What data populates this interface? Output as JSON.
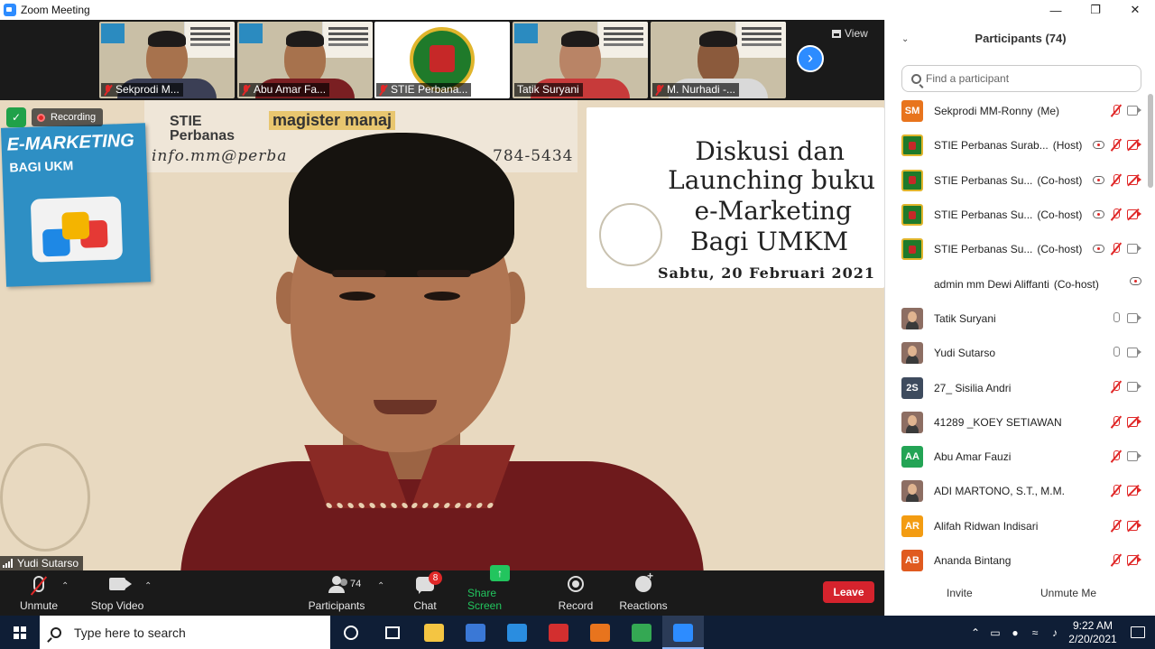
{
  "window": {
    "title": "Zoom Meeting"
  },
  "thumbnails": [
    {
      "name": "Sekprodi M..."
    },
    {
      "name": "Abu Amar Fa..."
    },
    {
      "name": "STIE Perbana..."
    },
    {
      "name": "Tatik Suryani"
    },
    {
      "name": "M. Nurhadi -..."
    }
  ],
  "view_label": "View",
  "main_video": {
    "recording_label": "Recording",
    "speaker_name": "Yudi Sutarso",
    "background": {
      "book_title_1": "E-MARKETING",
      "book_title_2": "BAGI UKM",
      "brand_1": "STIE\nPerbanas",
      "brand_2": "magister manaj",
      "email": "info.mm@perba",
      "phone": "784-5434",
      "event_line_1": "Diskusi dan",
      "event_line_2": "Launching buku",
      "event_line_3": "e-Marketing",
      "event_line_4": "Bagi UMKM",
      "event_date": "Sabtu, 20 Februari 2021"
    }
  },
  "toolbar": {
    "unmute": "Unmute",
    "stop_video": "Stop Video",
    "participants": "Participants",
    "participants_count": "74",
    "chat": "Chat",
    "chat_badge": "8",
    "share_screen": "Share Screen",
    "record": "Record",
    "reactions": "Reactions",
    "leave": "Leave"
  },
  "panel": {
    "title": "Participants (74)",
    "search_placeholder": "Find a participant",
    "invite": "Invite",
    "unmute_me": "Unmute Me",
    "participants": [
      {
        "initials": "SM",
        "color": "#e8741d",
        "avatar": "initials",
        "name": "Sekprodi MM-Ronny",
        "role": "(Me)",
        "cloud": false,
        "mic": "muted",
        "cam": "on"
      },
      {
        "initials": "",
        "color": "#1f7a2a",
        "avatar": "logo",
        "name": "STIE Perbanas Surab...",
        "role": "(Host)",
        "cloud": true,
        "mic": "muted",
        "cam": "off"
      },
      {
        "initials": "",
        "color": "#1f7a2a",
        "avatar": "logo",
        "name": "STIE Perbanas Su...",
        "role": "(Co-host)",
        "cloud": true,
        "mic": "muted",
        "cam": "off"
      },
      {
        "initials": "",
        "color": "#1f7a2a",
        "avatar": "logo",
        "name": "STIE Perbanas Su...",
        "role": "(Co-host)",
        "cloud": true,
        "mic": "muted",
        "cam": "off"
      },
      {
        "initials": "",
        "color": "#1f7a2a",
        "avatar": "logo",
        "name": "STIE Perbanas Su...",
        "role": "(Co-host)",
        "cloud": true,
        "mic": "muted",
        "cam": "on"
      },
      {
        "initials": "",
        "color": "",
        "avatar": "none",
        "name": "admin mm Dewi Aliffanti",
        "role": "(Co-host)",
        "cloud": true,
        "mic": "none",
        "cam": "none"
      },
      {
        "initials": "",
        "color": "#8d6e63",
        "avatar": "photo",
        "name": "Tatik Suryani",
        "role": "",
        "cloud": false,
        "mic": "on",
        "cam": "on"
      },
      {
        "initials": "",
        "color": "#8d6e63",
        "avatar": "photo",
        "name": "Yudi Sutarso",
        "role": "",
        "cloud": false,
        "mic": "on",
        "cam": "on"
      },
      {
        "initials": "2S",
        "color": "#3e4b5e",
        "avatar": "initials",
        "name": "27_ Sisilia Andri",
        "role": "",
        "cloud": false,
        "mic": "muted",
        "cam": "on"
      },
      {
        "initials": "",
        "color": "#8d6e63",
        "avatar": "photo",
        "name": "41289 _KOEY SETIAWAN",
        "role": "",
        "cloud": false,
        "mic": "muted",
        "cam": "off"
      },
      {
        "initials": "AA",
        "color": "#23a455",
        "avatar": "initials",
        "name": "Abu Amar Fauzi",
        "role": "",
        "cloud": false,
        "mic": "muted",
        "cam": "on"
      },
      {
        "initials": "",
        "color": "#8d6e63",
        "avatar": "photo",
        "name": "ADI MARTONO, S.T., M.M.",
        "role": "",
        "cloud": false,
        "mic": "muted",
        "cam": "off"
      },
      {
        "initials": "AR",
        "color": "#f39c12",
        "avatar": "initials",
        "name": "Alifah Ridwan Indisari",
        "role": "",
        "cloud": false,
        "mic": "muted",
        "cam": "off"
      },
      {
        "initials": "AB",
        "color": "#e05a1f",
        "avatar": "initials",
        "name": "Ananda Bintang",
        "role": "",
        "cloud": false,
        "mic": "muted",
        "cam": "off"
      }
    ]
  },
  "taskbar": {
    "search_placeholder": "Type here to search",
    "apps": [
      {
        "name": "file-explorer",
        "color": "#f4c542"
      },
      {
        "name": "store",
        "color": "#3a78d6"
      },
      {
        "name": "mail",
        "color": "#2a8de0"
      },
      {
        "name": "app-red",
        "color": "#d32f2f"
      },
      {
        "name": "pdf-app",
        "color": "#e8741d"
      },
      {
        "name": "chrome",
        "color": "#34a853"
      },
      {
        "name": "zoom",
        "color": "#2d8cff"
      }
    ],
    "time": "9:22 AM",
    "date": "2/20/2021"
  }
}
